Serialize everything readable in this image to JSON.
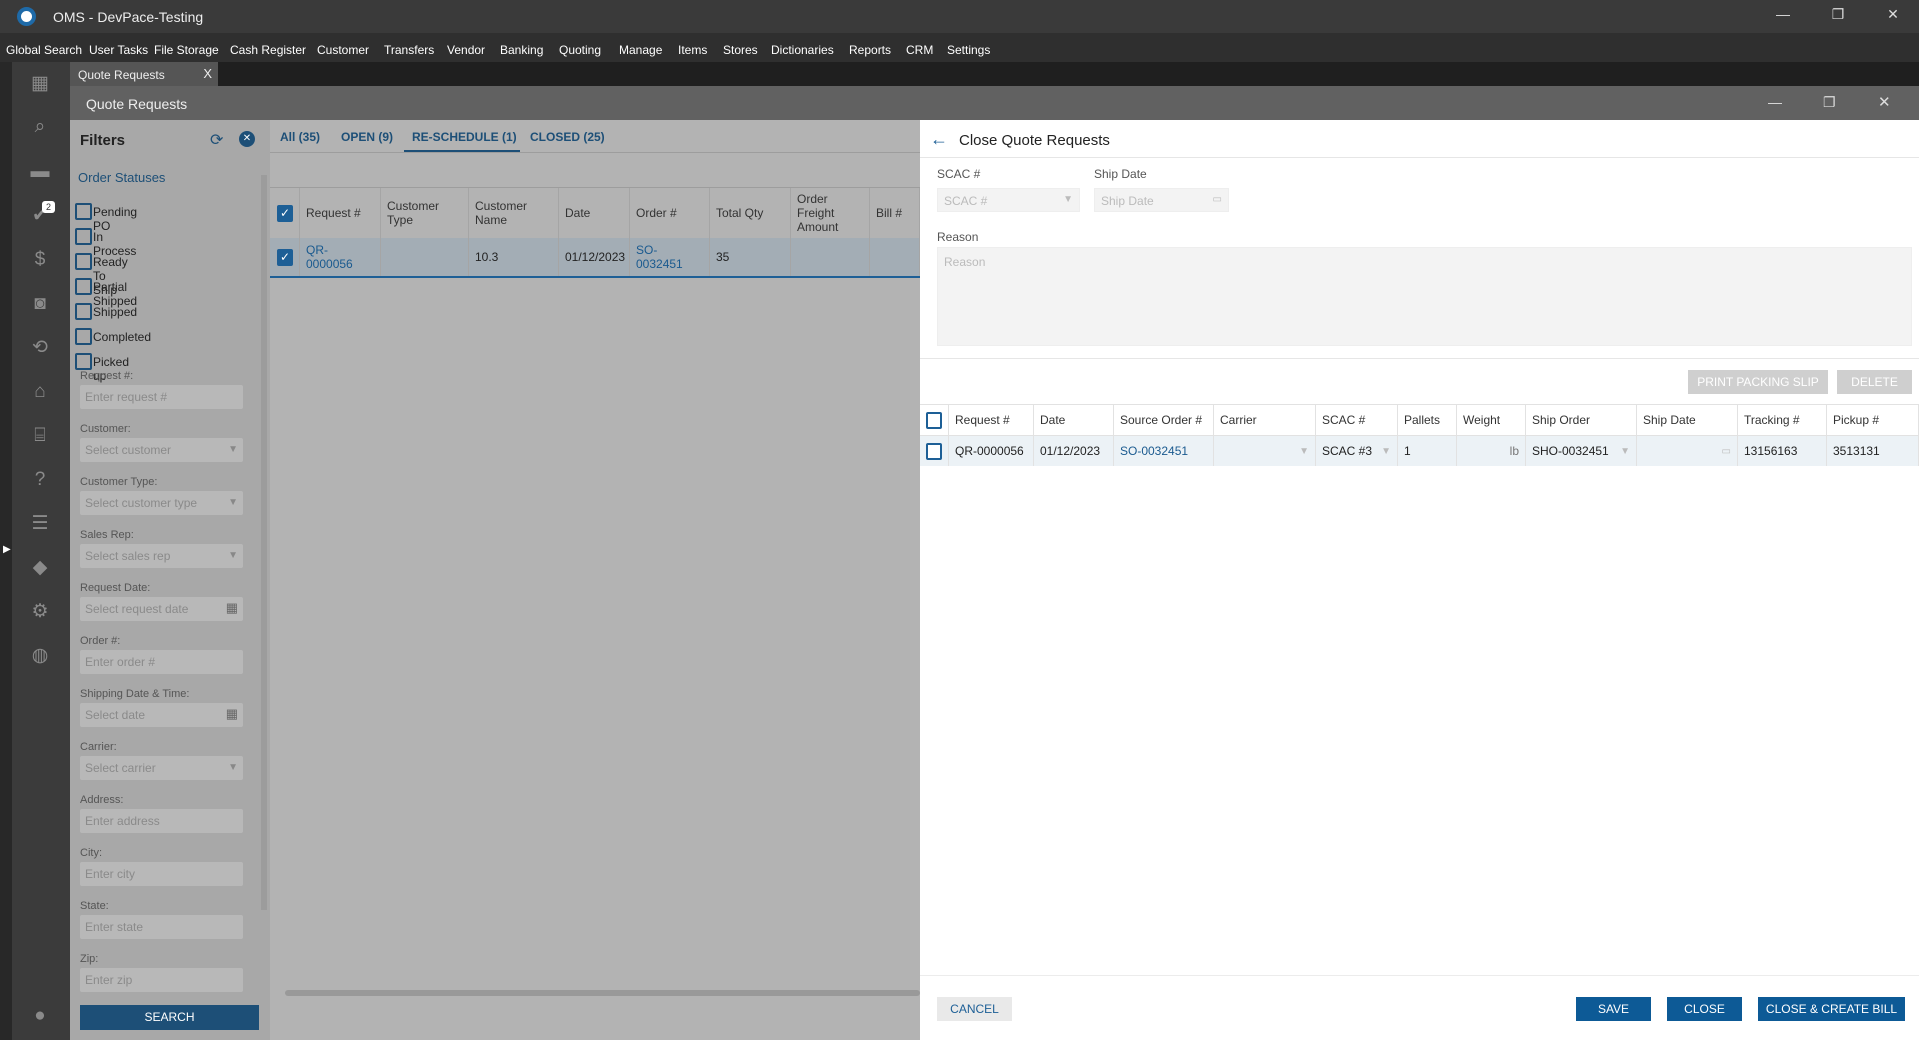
{
  "app": {
    "title": "OMS - DevPace-Testing"
  },
  "menu": [
    "Global Search",
    "User Tasks",
    "File Storage",
    "Cash Register",
    "Customer",
    "Transfers",
    "Vendor",
    "Banking",
    "Quoting",
    "Manage",
    "Items",
    "Stores",
    "Dictionaries",
    "Reports",
    "CRM",
    "Settings"
  ],
  "doc_tab": {
    "label": "Quote Requests",
    "close": "X"
  },
  "rail": {
    "badge": "2"
  },
  "window": {
    "title": "Quote Requests"
  },
  "filters": {
    "title": "Filters",
    "section": "Order Statuses",
    "statuses": [
      "Pending PO",
      "In Process",
      "Ready To Ship",
      "Partial Shipped",
      "Shipped",
      "Completed",
      "Picked up"
    ],
    "fields": [
      {
        "label": "Request #:",
        "placeholder": "Enter request #",
        "type": "text"
      },
      {
        "label": "Customer:",
        "placeholder": "Select customer",
        "type": "select"
      },
      {
        "label": "Customer Type:",
        "placeholder": "Select customer type",
        "type": "select"
      },
      {
        "label": "Sales Rep:",
        "placeholder": "Select sales rep",
        "type": "select"
      },
      {
        "label": "Request Date:",
        "placeholder": "Select request date",
        "type": "date"
      },
      {
        "label": "Order #:",
        "placeholder": "Enter order #",
        "type": "text"
      },
      {
        "label": "Shipping Date & Time:",
        "placeholder": "Select date",
        "type": "date"
      },
      {
        "label": "Carrier:",
        "placeholder": "Select carrier",
        "type": "select"
      },
      {
        "label": "Address:",
        "placeholder": "Enter address",
        "type": "text"
      },
      {
        "label": "City:",
        "placeholder": "Enter city",
        "type": "text"
      },
      {
        "label": "State:",
        "placeholder": "Enter state",
        "type": "text"
      },
      {
        "label": "Zip:",
        "placeholder": "Enter zip",
        "type": "text"
      }
    ],
    "search": "SEARCH"
  },
  "grid": {
    "tabs": [
      "All (35)",
      "OPEN (9)",
      "RE-SCHEDULE (1)",
      "CLOSED (25)"
    ],
    "columns": [
      "Request #",
      "Customer Type",
      "Customer Name",
      "Date",
      "Order #",
      "Total Qty",
      "Order Freight Amount",
      "Bill #"
    ],
    "rows": [
      [
        "QR-0000056",
        "",
        "10.3",
        "01/12/2023",
        "SO-0032451",
        "35",
        "",
        ""
      ]
    ]
  },
  "panel": {
    "title": "Close Quote Requests",
    "scac_label": "SCAC #",
    "scac_placeholder": "SCAC #",
    "shipdate_label": "Ship Date",
    "shipdate_placeholder": "Ship Date",
    "reason_label": "Reason",
    "reason_placeholder": "Reason",
    "print": "PRINT PACKING SLIP",
    "delete": "DELETE",
    "columns": [
      "Request #",
      "Date",
      "Source Order #",
      "Carrier",
      "SCAC #",
      "Pallets",
      "Weight",
      "Ship Order",
      "Ship Date",
      "Tracking #",
      "Pickup #"
    ],
    "row": {
      "request": "QR-0000056",
      "date": "01/12/2023",
      "source": "SO-0032451",
      "carrier": "",
      "scac": "SCAC #3",
      "pallets": "1",
      "weight_unit": "lb",
      "ship_order": "SHO-0032451",
      "ship_date": "",
      "tracking": "13156163",
      "pickup": "3513131"
    },
    "cancel": "CANCEL",
    "save": "SAVE",
    "close": "CLOSE",
    "close_bill": "CLOSE & CREATE BILL"
  }
}
